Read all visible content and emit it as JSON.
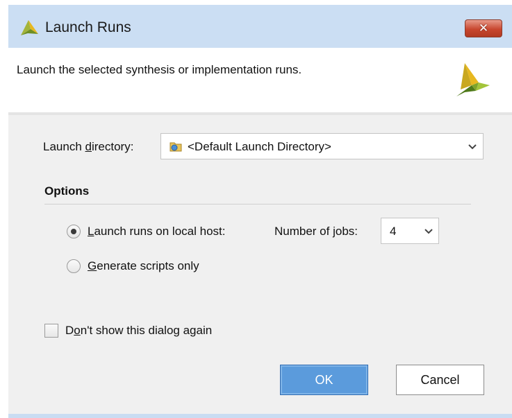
{
  "window": {
    "title": "Launch Runs",
    "close_label": "✕"
  },
  "header": {
    "description": "Launch the selected synthesis or implementation runs."
  },
  "launch_directory": {
    "label_pre": "Launch ",
    "label_mnemonic": "d",
    "label_post": "irectory:",
    "value": "<Default Launch Directory>"
  },
  "options": {
    "heading": "Options",
    "local_host": {
      "label_mnemonic": "L",
      "label_post": "aunch runs on local host:",
      "selected": true
    },
    "jobs": {
      "label_pre": "Number of ",
      "label_mnemonic": "j",
      "label_post": "obs:",
      "value": "4"
    },
    "scripts_only": {
      "label_mnemonic": "G",
      "label_post": "enerate scripts only",
      "selected": false
    }
  },
  "dont_show": {
    "label_pre": "D",
    "label_mnemonic": "o",
    "label_post": "n't show this dialog again",
    "checked": false
  },
  "buttons": {
    "ok_label": "OK",
    "cancel_label": "Cancel"
  },
  "colors": {
    "title_bar": "#cbdef3",
    "client_bg": "#f0f0f0",
    "ok_button": "#5b9bdc",
    "close_button": "#c8472f"
  },
  "icons": {
    "app_logo": "vivado-logo-icon",
    "folder": "folder-icon",
    "dropdown": "chevron-down-icon",
    "close": "close-icon"
  }
}
